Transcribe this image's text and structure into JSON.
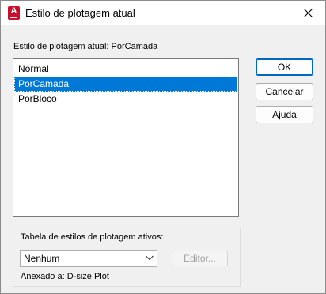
{
  "window": {
    "title": "Estilo de plotagem atual",
    "app_icon": "autocad-icon",
    "app_icon_letter": "A",
    "close_icon": "close-icon"
  },
  "current_style_label": "Estilo de plotagem atual: PorCamada",
  "styles_list": {
    "items": [
      {
        "label": "Normal",
        "selected": false
      },
      {
        "label": "PorCamada",
        "selected": true
      },
      {
        "label": "PorBloco",
        "selected": false
      }
    ],
    "selection_color": "#0078d7"
  },
  "buttons": {
    "ok": "OK",
    "cancel": "Cancelar",
    "help": "Ajuda"
  },
  "plot_style_table": {
    "label": "Tabela de estilos de plotagem ativos:",
    "selected_value": "Nenhum",
    "editor_label": "Editor...",
    "attached_label": "Anexado a:",
    "attached_value": "D-size Plot"
  }
}
